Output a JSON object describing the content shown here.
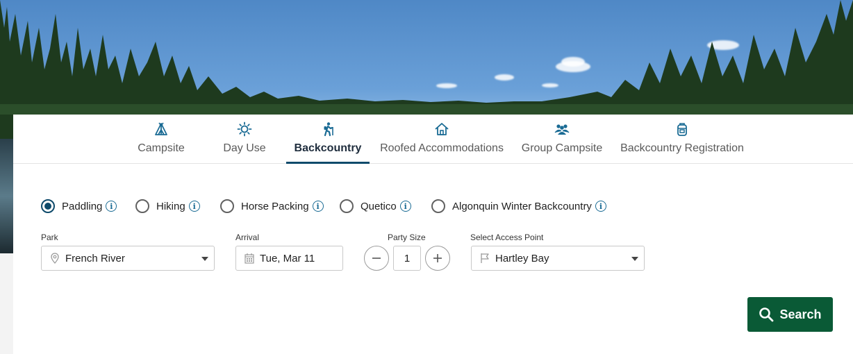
{
  "tabs": [
    {
      "label": "Campsite",
      "icon": "tent-icon"
    },
    {
      "label": "Day Use",
      "icon": "sun-icon"
    },
    {
      "label": "Backcountry",
      "icon": "hiker-icon"
    },
    {
      "label": "Roofed Accommodations",
      "icon": "house-icon"
    },
    {
      "label": "Group Campsite",
      "icon": "group-icon"
    },
    {
      "label": "Backcountry Registration",
      "icon": "backpack-icon"
    }
  ],
  "active_tab": "Backcountry",
  "trip_types": [
    {
      "label": "Paddling",
      "checked": true
    },
    {
      "label": "Hiking",
      "checked": false
    },
    {
      "label": "Horse Packing",
      "checked": false
    },
    {
      "label": "Quetico",
      "checked": false
    },
    {
      "label": "Algonquin Winter Backcountry",
      "checked": false
    }
  ],
  "form": {
    "park_label": "Park",
    "park_value": "French River",
    "arrival_label": "Arrival",
    "arrival_value": "Tue, Mar 11",
    "party_label": "Party Size",
    "party_value": "1",
    "access_label": "Select Access Point",
    "access_value": "Hartley Bay"
  },
  "search_label": "Search",
  "colors": {
    "accent": "#0e4a6b",
    "search_button": "#0a5a36",
    "info_icon": "#1a6b94"
  }
}
